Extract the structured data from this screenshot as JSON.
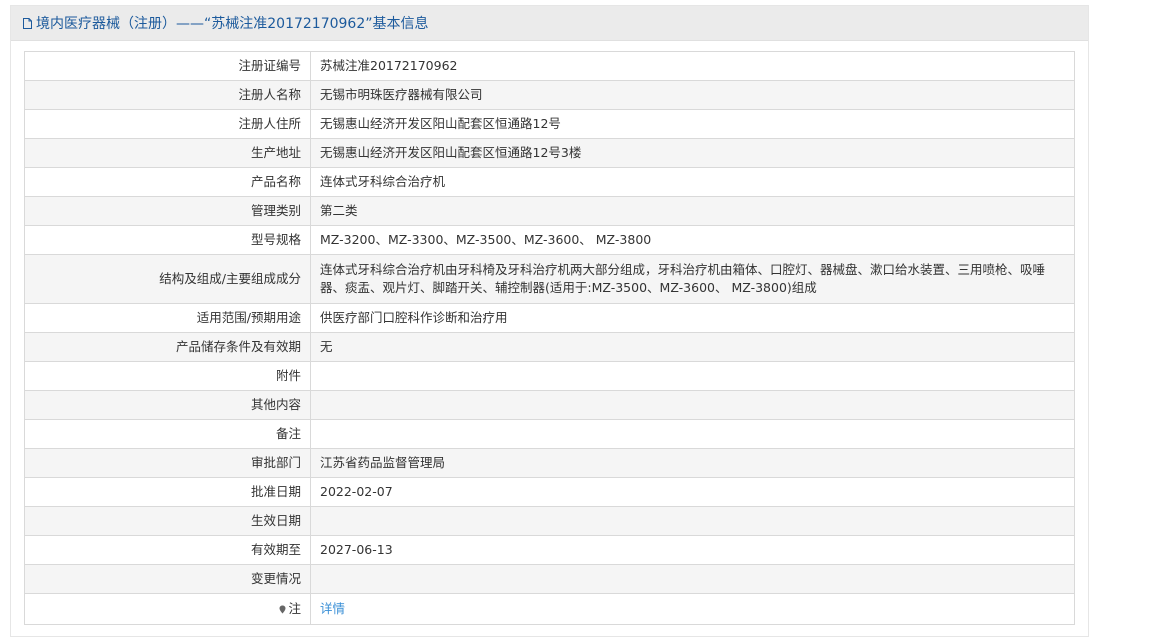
{
  "header": {
    "title": "境内医疗器械（注册）——“苏械注准20172170962”基本信息"
  },
  "rows": [
    {
      "label": "注册证编号",
      "value": "苏械注准20172170962"
    },
    {
      "label": "注册人名称",
      "value": "无锡市明珠医疗器械有限公司"
    },
    {
      "label": "注册人住所",
      "value": "无锡惠山经济开发区阳山配套区恒通路12号"
    },
    {
      "label": "生产地址",
      "value": "无锡惠山经济开发区阳山配套区恒通路12号3楼"
    },
    {
      "label": "产品名称",
      "value": "连体式牙科综合治疗机"
    },
    {
      "label": "管理类别",
      "value": "第二类"
    },
    {
      "label": "型号规格",
      "value": "MZ-3200、MZ-3300、MZ-3500、MZ-3600、 MZ-3800"
    },
    {
      "label": "结构及组成/主要组成成分",
      "value": "连体式牙科综合治疗机由牙科椅及牙科治疗机两大部分组成，牙科治疗机由箱体、口腔灯、器械盘、漱口给水装置、三用喷枪、吸唾器、痰盂、观片灯、脚踏开关、辅控制器(适用于:MZ-3500、MZ-3600、 MZ-3800)组成"
    },
    {
      "label": "适用范围/预期用途",
      "value": "供医疗部门口腔科作诊断和治疗用"
    },
    {
      "label": "产品储存条件及有效期",
      "value": "无"
    },
    {
      "label": "附件",
      "value": ""
    },
    {
      "label": "其他内容",
      "value": ""
    },
    {
      "label": "备注",
      "value": ""
    },
    {
      "label": "审批部门",
      "value": "江苏省药品监督管理局"
    },
    {
      "label": "批准日期",
      "value": "2022-02-07"
    },
    {
      "label": "生效日期",
      "value": ""
    },
    {
      "label": "有效期至",
      "value": "2027-06-13"
    },
    {
      "label": "变更情况",
      "value": ""
    }
  ],
  "note": {
    "label": "注",
    "link_text": "详情"
  },
  "colors": {
    "header_bg": "#ebebeb",
    "title_color": "#1c5a9c",
    "link_color": "#3a8fd6",
    "border": "#d9d9d9",
    "stripe": "#f5f5f5"
  }
}
